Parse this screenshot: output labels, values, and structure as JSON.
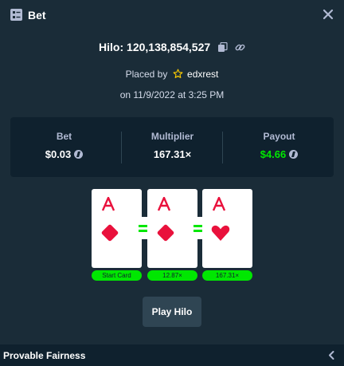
{
  "header": {
    "title": "Bet",
    "icon": "bet-list-icon",
    "close_icon": "close-icon"
  },
  "game": {
    "id_label": "Hilo: 120,138,854,527",
    "copy_icon": "copy-icon",
    "link_icon": "link-icon"
  },
  "placed": {
    "prefix": "Placed by",
    "user": "edxrest",
    "user_icon": "star-icon",
    "date": "on 11/9/2022 at 3:25 PM"
  },
  "stats": {
    "bet": {
      "label": "Bet",
      "value": "$0.03",
      "coin_icon": "litecoin-icon"
    },
    "multiplier": {
      "label": "Multiplier",
      "value": "167.31×"
    },
    "payout": {
      "label": "Payout",
      "value": "$4.66",
      "coin_icon": "litecoin-icon"
    }
  },
  "cards": [
    {
      "rank": "A",
      "suit": "diamond",
      "tag": "Start Card"
    },
    {
      "rank": "A",
      "suit": "diamond",
      "tag": "12.87×"
    },
    {
      "rank": "A",
      "suit": "heart",
      "tag": "167.31×"
    }
  ],
  "play_button": "Play Hilo",
  "footer": {
    "label": "Provable Fairness",
    "chevron_icon": "chevron-left-icon"
  },
  "colors": {
    "background": "#1a2c38",
    "panel": "#0f212e",
    "accent_green": "#00e701",
    "card_red": "#e9113c",
    "button": "#2f4553"
  }
}
